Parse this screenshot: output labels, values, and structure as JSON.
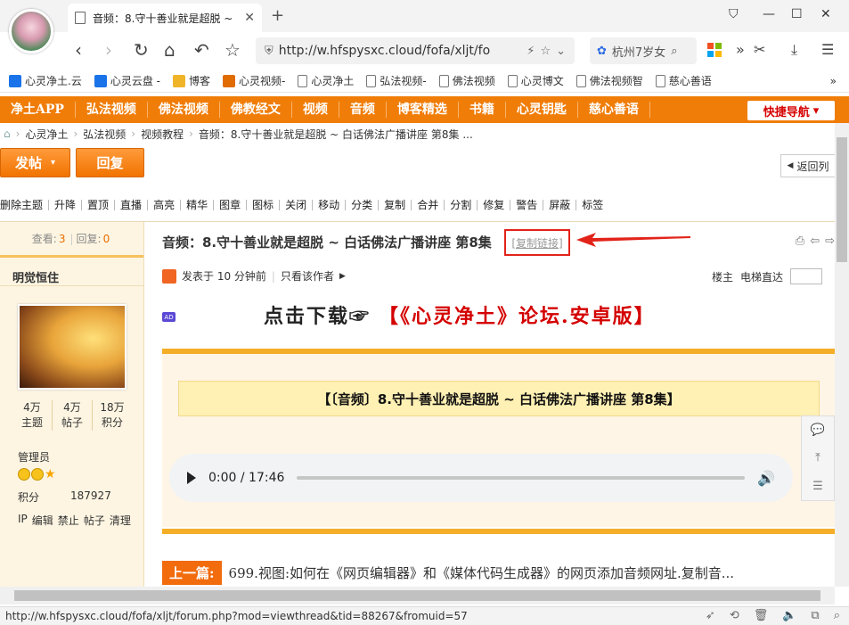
{
  "browser": {
    "tab_title": "音频：8.守十善业就是超脱 ~",
    "url": "http://w.hfspysxc.cloud/fofa/xljt/fo",
    "search_text": "杭州7岁女",
    "status_url": "http://w.hfspysxc.cloud/fofa/xljt/forum.php?mod=viewthread&tid=88267&fromuid=57"
  },
  "bookmarks": [
    {
      "label": "心灵净土.云",
      "color": "#1a73e8"
    },
    {
      "label": "心灵云盘 -",
      "color": "#1a73e8"
    },
    {
      "label": "博客",
      "color": "#f0b429"
    },
    {
      "label": "心灵视频-",
      "color": "#e06b00"
    },
    {
      "label": "心灵净土",
      "color": ""
    },
    {
      "label": "弘法视频-",
      "color": ""
    },
    {
      "label": "佛法视频",
      "color": ""
    },
    {
      "label": "心灵博文",
      "color": ""
    },
    {
      "label": "佛法视频智",
      "color": ""
    },
    {
      "label": "慈心善语",
      "color": ""
    }
  ],
  "orange_nav": [
    "净土APP",
    "弘法视频",
    "佛法视频",
    "佛教经文",
    "视频",
    "音频",
    "博客精选",
    "书籍",
    "心灵钥匙",
    "慈心善语"
  ],
  "quick_nav": "快捷导航",
  "breadcrumb": [
    "心灵净土",
    "弘法视频",
    "视频教程",
    "音频：8.守十善业就是超脱 ~ 白话佛法广播讲座 第8集 ..."
  ],
  "buttons": {
    "post": "发帖",
    "reply": "回复",
    "back": "返回列"
  },
  "mod_tools": [
    "删除主题",
    "升降",
    "置顶",
    "直播",
    "高亮",
    "精华",
    "图章",
    "图标",
    "关闭",
    "移动",
    "分类",
    "复制",
    "合并",
    "分割",
    "修复",
    "警告",
    "屏蔽",
    "标签"
  ],
  "sidebar": {
    "views_label": "查看:",
    "views": "3",
    "replies_label": "回复:",
    "replies": "0",
    "username": "明觉恒住",
    "stats": [
      {
        "value": "4万",
        "label": "主题"
      },
      {
        "value": "4万",
        "label": "帖子"
      },
      {
        "value": "18万",
        "label": "积分"
      }
    ],
    "role": "管理员",
    "points_label": "积分",
    "points": "187927",
    "actions": [
      "IP",
      "编辑",
      "禁止",
      "帖子",
      "清理"
    ]
  },
  "post": {
    "title": "音频：8.守十善业就是超脱 ~ 白话佛法广播讲座 第8集",
    "copy_link": "[复制链接]",
    "posted": "发表于 10 分钟前",
    "author_only": "只看该作者",
    "floor": "楼主",
    "jump": "电梯直达",
    "ad_badge": "AD",
    "ad_download": "点击下载☞",
    "ad_app": "【《心灵净土》论坛.安卓版】",
    "content_title": "【〔音频〕8.守十善业就是超脱 ~ 白话佛法广播讲座 第8集】",
    "audio_time": "0:00 / 17:46",
    "prev_label": "上一篇:",
    "prev_text": "699.视图:如何在《网页编辑器》和《媒体代码生成器》的网页添加音频网址.复制音..."
  },
  "colors": {
    "orange": "#f07d08",
    "highlight_red": "#e2231a",
    "gold": "#f4ae28"
  }
}
